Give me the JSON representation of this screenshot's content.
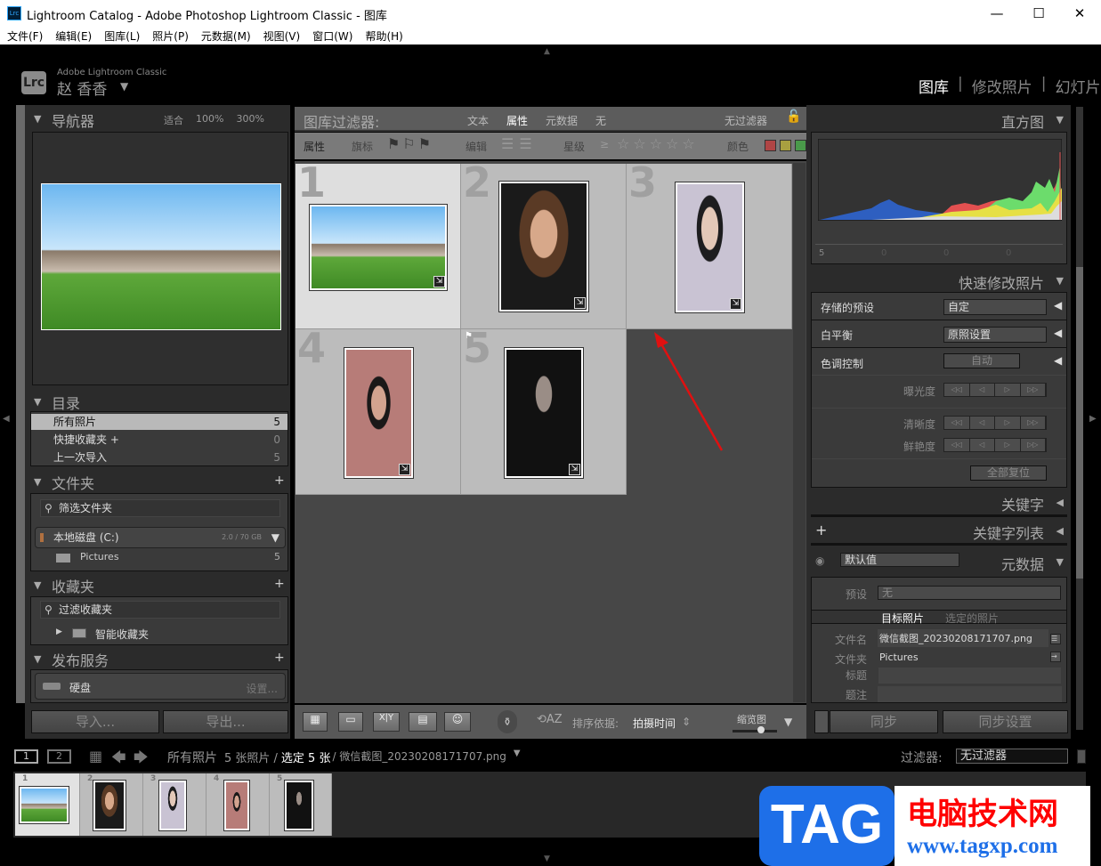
{
  "window": {
    "title": "Lightroom Catalog - Adobe Photoshop Lightroom Classic - 图库",
    "app_icon": "Lrc",
    "minimize": "—",
    "maximize": "☐",
    "close": "✕"
  },
  "menu": [
    "文件(F)",
    "编辑(E)",
    "图库(L)",
    "照片(P)",
    "元数据(M)",
    "视图(V)",
    "窗口(W)",
    "帮助(H)"
  ],
  "identity": {
    "logo": "Lrc",
    "product": "Adobe Lightroom Classic",
    "user": "赵 香香"
  },
  "modules": [
    "图库",
    "修改照片",
    "幻灯片"
  ],
  "navigator": {
    "title": "导航器",
    "zoom": [
      "适合",
      "100%",
      "300%"
    ]
  },
  "catalog": {
    "title": "目录",
    "items": [
      {
        "label": "所有照片",
        "count": "5"
      },
      {
        "label": "快捷收藏夹 +",
        "count": "0"
      },
      {
        "label": "上一次导入",
        "count": "5"
      }
    ]
  },
  "folders": {
    "title": "文件夹",
    "filter_placeholder": "筛选文件夹",
    "volume": "本地磁盘 (C:)",
    "volume_size": "2.0 / 70 GB",
    "folder": "Pictures",
    "folder_count": "5"
  },
  "collections": {
    "title": "收藏夹",
    "filter_placeholder": "过滤收藏夹",
    "smart": "智能收藏夹"
  },
  "publish": {
    "title": "发布服务",
    "service": "硬盘",
    "settings": "设置..."
  },
  "left_buttons": {
    "import": "导入...",
    "export": "导出..."
  },
  "filter": {
    "title": "图库过滤器:",
    "tabs": [
      "文本",
      "属性",
      "元数据",
      "无"
    ],
    "active_tab": "属性",
    "preset": "无过滤器",
    "attr_label": "属性",
    "flag_label": "旗标",
    "edit_label": "编辑",
    "rating_label": "星级",
    "rating_op": "≥",
    "color_label": "颜色"
  },
  "grid": {
    "cells": [
      {
        "num": "1"
      },
      {
        "num": "2"
      },
      {
        "num": "3"
      },
      {
        "num": "4"
      },
      {
        "num": "5"
      }
    ],
    "badge": "⇲"
  },
  "toolbar": {
    "sort_label": "排序依据:",
    "sort_value": "拍摄时间",
    "thumb_label": "缩览图"
  },
  "histogram": {
    "title": "直方图",
    "stats": [
      "5",
      "0",
      "0",
      "0"
    ]
  },
  "quick_develop": {
    "title": "快速修改照片",
    "saved_preset_label": "存储的预设",
    "saved_preset": "自定",
    "wb_label": "白平衡",
    "wb": "原照设置",
    "tone_label": "色调控制",
    "auto": "自动",
    "sliders": [
      "曝光度",
      "清晰度",
      "鲜艳度"
    ],
    "reset": "全部复位"
  },
  "keywording": {
    "title": "关键字"
  },
  "keyword_list": {
    "title": "关键字列表"
  },
  "metadata": {
    "title": "元数据",
    "view": "默认值",
    "preset_label": "预设",
    "preset": "无",
    "tab_target": "目标照片",
    "tab_selected": "选定的照片",
    "fields": [
      {
        "label": "文件名",
        "value": "微信截图_20230208171707.png"
      },
      {
        "label": "文件夹",
        "value": "Pictures"
      },
      {
        "label": "标题",
        "value": ""
      },
      {
        "label": "题注",
        "value": ""
      }
    ]
  },
  "right_buttons": {
    "sync": "同步",
    "sync_settings": "同步设置"
  },
  "filmstrip": {
    "view1": "1",
    "view2": "2",
    "source": "所有照片",
    "count": "5 张照片 /",
    "selected": "选定 5 张",
    "file": "/ 微信截图_20230208171707.png",
    "filter_label": "过滤器:",
    "filter_value": "无过滤器",
    "items": [
      "1",
      "2",
      "3",
      "4",
      "5"
    ]
  },
  "watermark": {
    "logo": "TAG",
    "site_name": "电脑技术网",
    "url": "www.tagxp.com"
  }
}
